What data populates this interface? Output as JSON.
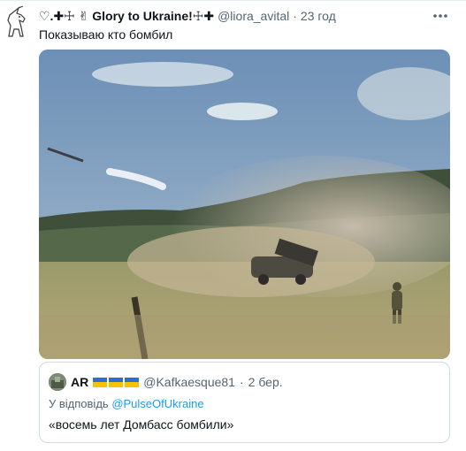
{
  "tweet": {
    "display_name": "♡.✚☩ ✌ Glory to Ukraine!☩✚",
    "handle": "@liora_avital",
    "separator": "·",
    "time": "23 год",
    "more_icon": "more-horizontal-icon",
    "text": "Показываю кто бомбил",
    "media_icon": "video-thumbnail"
  },
  "quote": {
    "display_name": "AR",
    "flags_count": 3,
    "handle": "@Kafkaesque81",
    "separator": "·",
    "time": "2 бер.",
    "reply_prefix": "У відповідь",
    "reply_to": "@PulseOfUkraine",
    "text": "«восемь лет Домбасс бомбили»"
  },
  "colors": {
    "text_primary": "#0f1419",
    "text_secondary": "#536471",
    "link": "#1d9bf0",
    "border": "#cfd9de",
    "flag_blue": "#2d6fd1",
    "flag_yellow": "#f5c400"
  }
}
